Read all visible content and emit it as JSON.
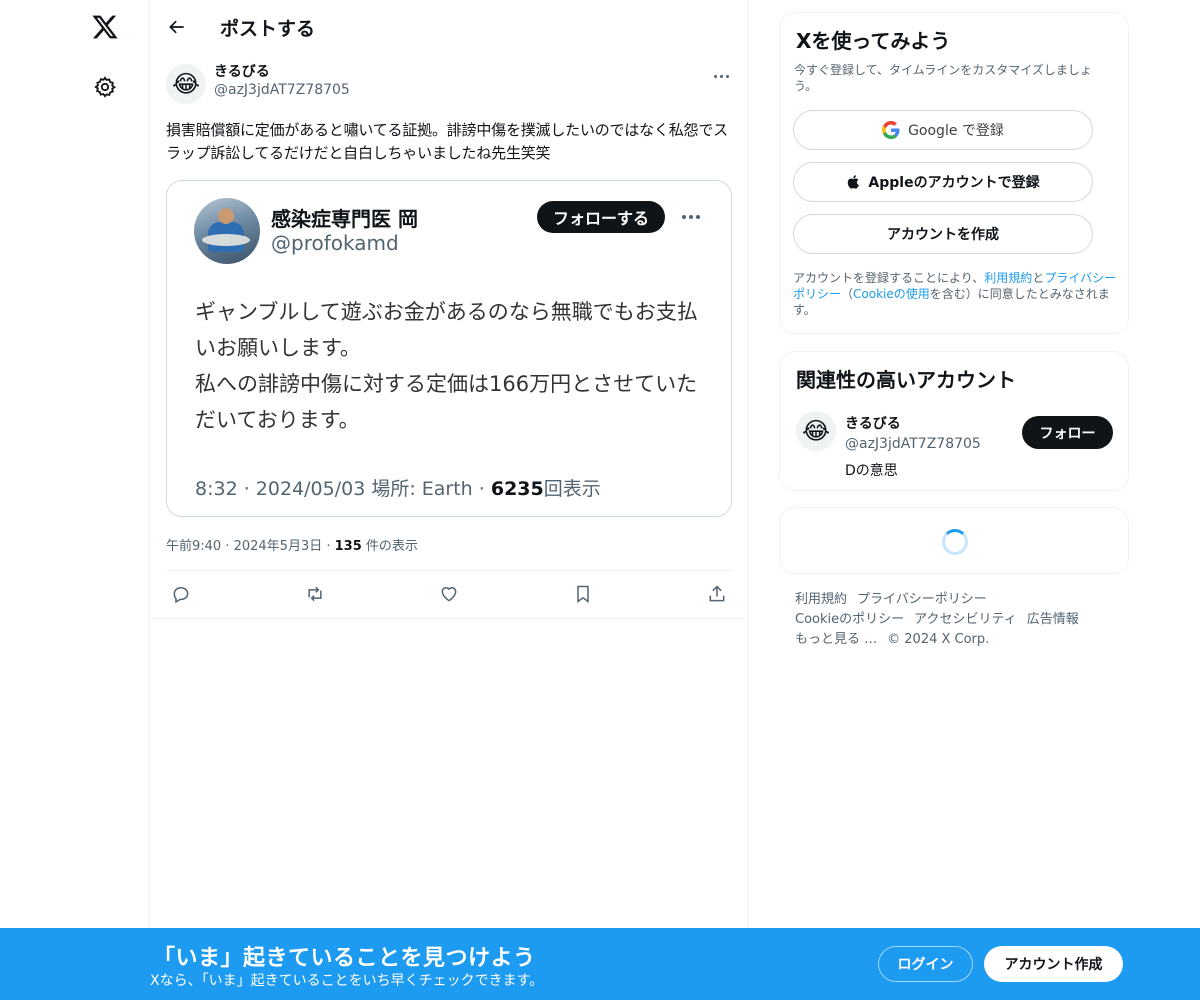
{
  "header": {
    "title": "ポストする"
  },
  "post": {
    "author_avatar": "😂",
    "author_name": "きるびる",
    "author_handle": "@azJ3jdAT7Z78705",
    "text": "損害賠償額に定価があると嘯いてる証拠。誹謗中傷を撲滅したいのではなく私怨でスラップ訴訟してるだけだと自白しちゃいましたね先生笑笑",
    "embed": {
      "name": "感染症専門医 岡",
      "handle": "@profokamd",
      "follow_label": "フォローする",
      "text_line1": "ギャンブルして遊ぶお金があるのなら無職でもお支払いお願いします。",
      "text_line2": "私への誹謗中傷に対する定価は166万円とさせていただいております。",
      "meta_prefix": "8:32 · 2024/05/03 場所: Earth · ",
      "views": "6235",
      "views_suffix": "回表示"
    },
    "time": "午前9:40 · 2024年5月3日 · ",
    "view_count": "135",
    "view_suffix": " 件の表示",
    "actions": [
      "reply",
      "repost",
      "like",
      "bookmark",
      "share"
    ]
  },
  "signup": {
    "title": "Xを使ってみよう",
    "subtitle": "今すぐ登録して、タイムラインをカスタマイズしましょう。",
    "google_label": "Google で登録",
    "apple_label": "Appleのアカウントで登録",
    "create_label": "アカウントを作成",
    "terms_prefix": "アカウントを登録することにより、",
    "terms_link": "利用規約",
    "terms_and": "と",
    "privacy_link": "プライバシーポリシー",
    "terms_paren_open": "（",
    "cookie_link": "Cookieの使用",
    "terms_suffix": "を含む）に同意したとみなされます。"
  },
  "related": {
    "title": "関連性の高いアカウント",
    "avatar": "😂",
    "name": "きるびる",
    "handle": "@azJ3jdAT7Z78705",
    "bio": "Dの意思",
    "follow_label": "フォロー"
  },
  "footer": {
    "terms": "利用規約",
    "privacy": "プライバシーポリシー",
    "cookie": "Cookieのポリシー",
    "accessibility": "アクセシビリティ",
    "ads": "広告情報",
    "more": "もっと見る …",
    "copyright": "© 2024 X Corp."
  },
  "banner": {
    "title": "「いま」起きていることを見つけよう",
    "subtitle": "Xなら、「いま」起きていることをいち早くチェックできます。",
    "login_label": "ログイン",
    "signup_label": "アカウント作成"
  },
  "colors": {
    "accent": "#1d9bf0",
    "text": "#0f1419",
    "muted": "#536471",
    "border": "#eff3f4"
  }
}
